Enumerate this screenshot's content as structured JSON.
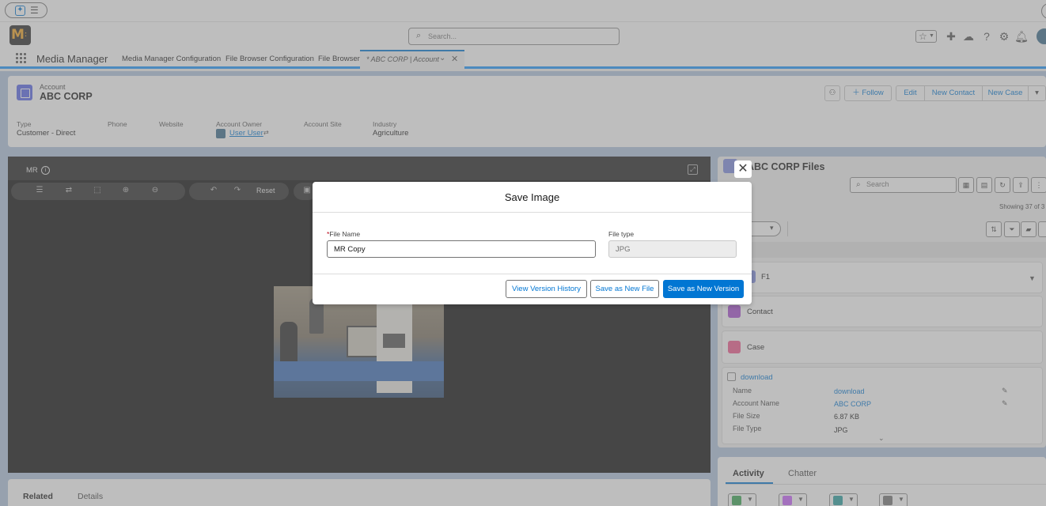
{
  "header": {
    "search_placeholder": "Search..."
  },
  "nav": {
    "app_name": "Media Manager",
    "tabs": [
      "Media Manager Configuration",
      "File Browser Configuration",
      "File Browser"
    ],
    "active_tab": "* ABC CORP | Account"
  },
  "record": {
    "object_label": "Account",
    "name": "ABC CORP",
    "actions": {
      "follow": "Follow",
      "edit": "Edit",
      "new_contact": "New Contact",
      "new_case": "New Case"
    },
    "fields": {
      "type_label": "Type",
      "type_value": "Customer - Direct",
      "phone_label": "Phone",
      "website_label": "Website",
      "owner_label": "Account Owner",
      "owner_value": "User User",
      "site_label": "Account Site",
      "industry_label": "Industry",
      "industry_value": "Agriculture"
    }
  },
  "editor": {
    "image_name": "MR",
    "reset_label": "Reset"
  },
  "lower_tabs": {
    "related": "Related",
    "details": "Details"
  },
  "files": {
    "title": "ABC CORP Files",
    "search_placeholder": "Search",
    "showing": "Showing 37 of 3",
    "groups": {
      "f1": "F1",
      "contact": "Contact",
      "case": "Case"
    },
    "item": {
      "title": "download",
      "name_label": "Name",
      "name_value": "download",
      "account_label": "Account Name",
      "account_value": "ABC CORP",
      "size_label": "File Size",
      "size_value": "6.87 KB",
      "type_label": "File Type",
      "type_value": "JPG"
    }
  },
  "activity": {
    "activity_tab": "Activity",
    "chatter_tab": "Chatter"
  },
  "modal": {
    "title": "Save Image",
    "file_name_label": "File Name",
    "file_name_value": "MR Copy",
    "file_type_label": "File type",
    "file_type_value": "JPG",
    "view_history": "View Version History",
    "save_new_file": "Save as New File",
    "save_new_version": "Save as New Version"
  },
  "colors": {
    "brand": "#0176d3",
    "nav_accent": "#1b96ff",
    "background_band": "#b0c4df"
  }
}
